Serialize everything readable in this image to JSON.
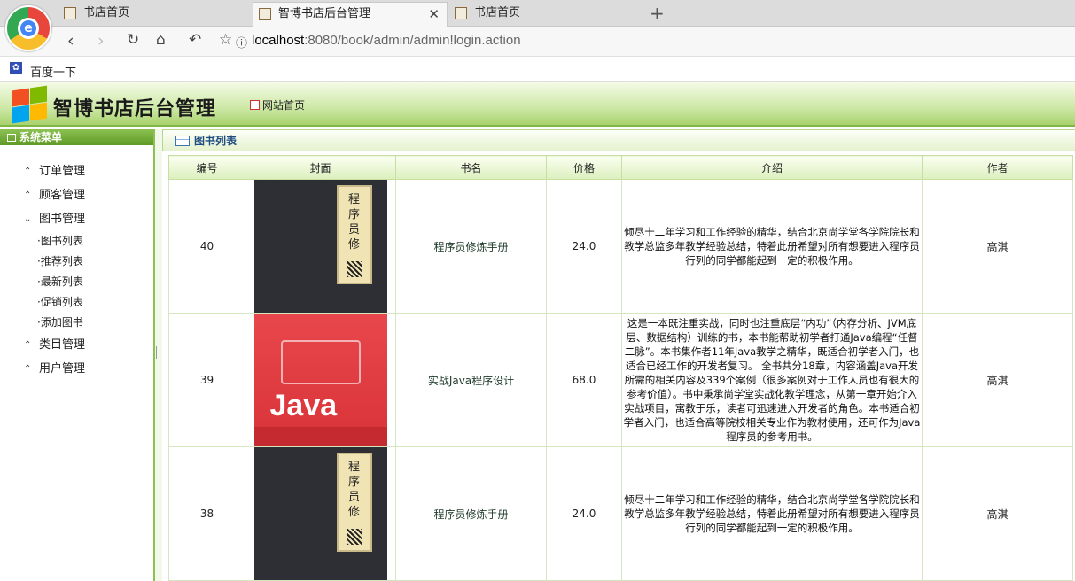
{
  "browser": {
    "tabs": [
      {
        "label": "书店首页",
        "active": false
      },
      {
        "label": "智博书店后台管理",
        "active": true
      },
      {
        "label": "书店首页",
        "active": false
      }
    ],
    "address": {
      "host": "localhost",
      "path": ":8080/book/admin/admin!login.action"
    },
    "bookmark": "百度一下"
  },
  "header": {
    "title": "智博书店后台管理",
    "home_link": "网站首页"
  },
  "sidebar": {
    "title": "系统菜单",
    "items": [
      {
        "label": "订单管理",
        "expanded": false
      },
      {
        "label": "顾客管理",
        "expanded": false
      },
      {
        "label": "图书管理",
        "expanded": true
      },
      {
        "label": "类目管理",
        "expanded": false
      },
      {
        "label": "用户管理",
        "expanded": false
      }
    ],
    "book_subitems": [
      "·图书列表",
      "·推荐列表",
      "·最新列表",
      "·促销列表",
      "·添加图书"
    ]
  },
  "main": {
    "title": "图书列表",
    "columns": [
      "编号",
      "封面",
      "书名",
      "价格",
      "介绍",
      "作者"
    ],
    "rows": [
      {
        "id": "40",
        "cover": "dark",
        "name": "程序员修炼手册",
        "price": "24.0",
        "intro": "倾尽十二年学习和工作经验的精华，结合北京尚学堂各学院院长和教学总监多年教学经验总结，特着此册希望对所有想要进入程序员行列的同学都能起到一定的积极作用。",
        "author": "高淇"
      },
      {
        "id": "39",
        "cover": "red",
        "name": "实战Java程序设计",
        "price": "68.0",
        "intro": "这是一本既注重实战，同时也注重底层“内功”（内存分析、JVM底层、数据结构）训练的书，本书能帮助初学者打通Java编程“任督二脉”。本书集作者11年Java教学之精华，既适合初学者入门，也适合已经工作的开发者复习。 全书共分18章，内容涵盖Java开发所需的相关内容及339个案例（很多案例对于工作人员也有很大的参考价值）。书中秉承尚学堂实战化教学理念，从第一章开始介入实战项目，寓教于乐，读者可迅速进入开发者的角色。本书适合初学者入门，也适合高等院校相关专业作为教材使用，还可作为Java程序员的参考用书。",
        "author": "高淇"
      },
      {
        "id": "38",
        "cover": "dark",
        "name": "程序员修炼手册",
        "price": "24.0",
        "intro": "倾尽十二年学习和工作经验的精华，结合北京尚学堂各学院院长和教学总监多年教学经验总结，特着此册希望对所有想要进入程序员行列的同学都能起到一定的积极作用。",
        "author": "高淇"
      }
    ]
  },
  "colors": {
    "accent_green": "#8cc152",
    "header_green": "#a9d26e",
    "title_blue": "#1f4d82"
  }
}
